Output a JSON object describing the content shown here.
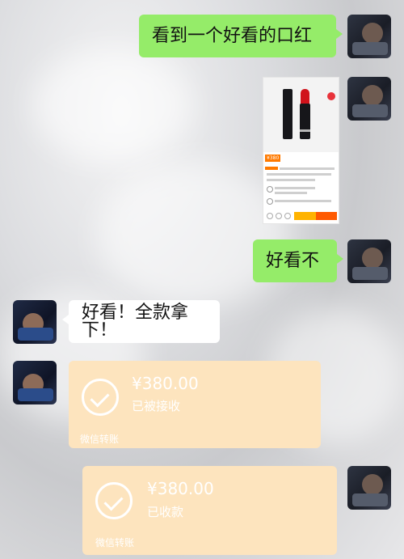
{
  "messages": {
    "m1": "看到一个好看的口红",
    "m3": "好看不",
    "m4": "好看！全款拿下！"
  },
  "product_card": {
    "price_tag": "¥380"
  },
  "transfers": [
    {
      "amount": "¥380.00",
      "status": "已被接收",
      "brand": "微信转账"
    },
    {
      "amount": "¥380.00",
      "status": "已收款",
      "brand": "微信转账"
    }
  ],
  "colors": {
    "green_bubble": "#95ec69",
    "transfer_bg": "#fde4be",
    "lipstick": "#d0121b"
  }
}
